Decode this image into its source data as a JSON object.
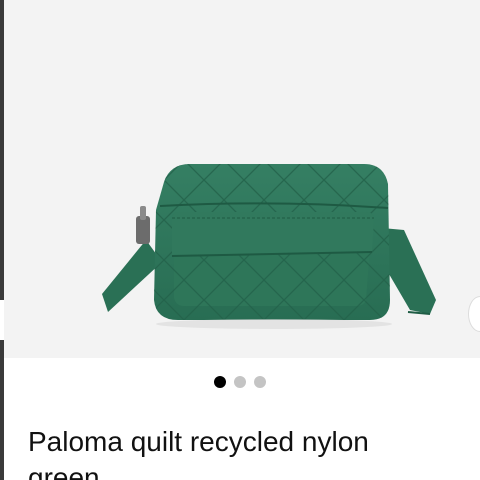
{
  "product": {
    "title": "Paloma quilt recycled nylon\ngreen",
    "image_alt": "green quilted crossbody bag",
    "color": "#2f7a5e"
  },
  "carousel": {
    "dot_count": 3,
    "active_index": 0
  },
  "colors": {
    "bag": "#2f7a5e",
    "bag_dark": "#1f5d45",
    "background": "#f3f3f3",
    "dot_active": "#000000",
    "dot_inactive": "#c4c4c4"
  }
}
